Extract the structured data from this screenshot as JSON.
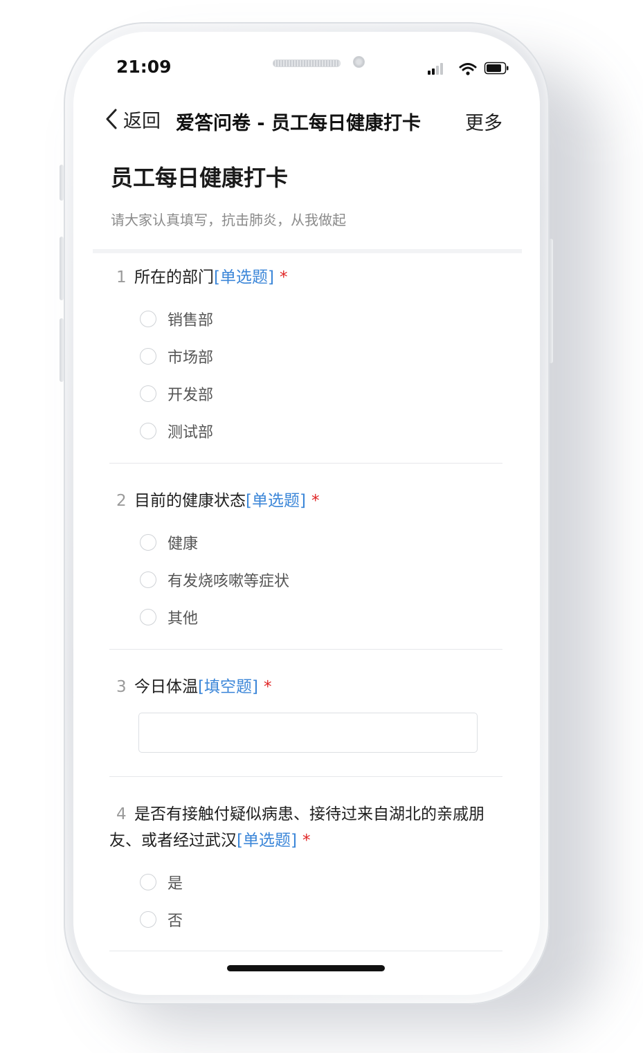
{
  "status_bar": {
    "time": "21:09"
  },
  "nav": {
    "back_label": "返回",
    "title": "爱答问卷 - 员工每日健康打卡",
    "more_label": "更多"
  },
  "form": {
    "title": "员工每日健康打卡",
    "description": "请大家认真填写，抗击肺炎，从我做起"
  },
  "questions": [
    {
      "number": "1",
      "text": "所在的部门",
      "type": "[单选题]",
      "required": "*",
      "options": [
        "销售部",
        "市场部",
        "开发部",
        "测试部"
      ]
    },
    {
      "number": "2",
      "text": "目前的健康状态",
      "type": "[单选题]",
      "required": "*",
      "options": [
        "健康",
        "有发烧咳嗽等症状",
        "其他"
      ]
    },
    {
      "number": "3",
      "text": "今日体温",
      "type": "[填空题]",
      "required": "*",
      "input_value": ""
    },
    {
      "number": "4",
      "text": "是否有接触付疑似病患、接待过来自湖北的亲戚朋友、或者经过武汉",
      "type": "[单选题]",
      "required": "*",
      "options": [
        "是",
        "否"
      ]
    }
  ],
  "icons": {
    "back": "chevron-left-icon",
    "signal": "cellular-signal-icon",
    "wifi": "wifi-icon",
    "battery": "battery-icon"
  },
  "colors": {
    "accent": "#3b86d8",
    "required": "#e02424"
  }
}
